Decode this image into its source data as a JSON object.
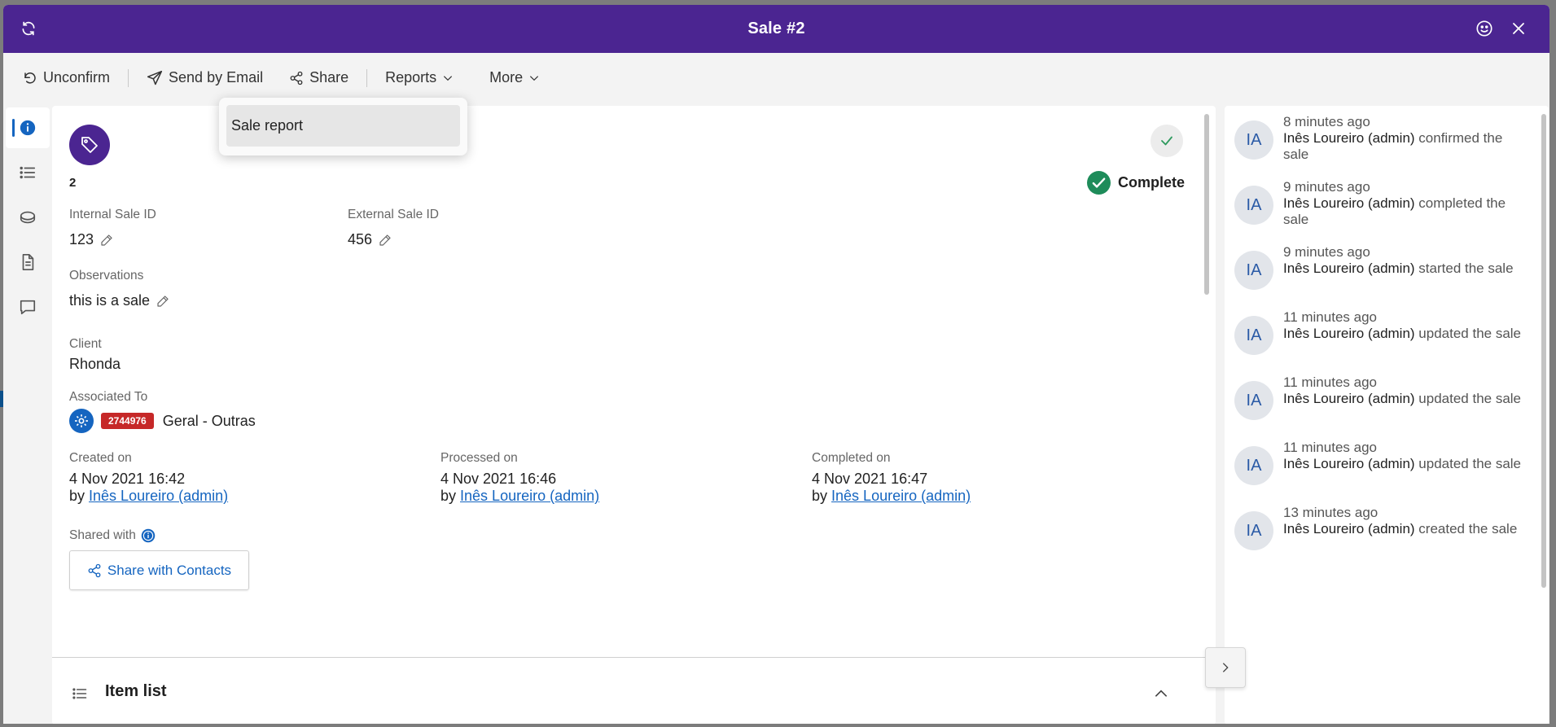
{
  "window": {
    "title": "Sale #2"
  },
  "toolbar": {
    "unconfirm": "Unconfirm",
    "send_email": "Send by Email",
    "share": "Share",
    "reports": "Reports",
    "more": "More"
  },
  "reports_menu": {
    "items": [
      "Sale report"
    ]
  },
  "sale": {
    "number": "2",
    "status": "Complete",
    "internal_id_label": "Internal Sale ID",
    "internal_id": "123",
    "external_id_label": "External Sale ID",
    "external_id": "456",
    "observations_label": "Observations",
    "observations": "this is a sale",
    "client_label": "Client",
    "client": "Rhonda",
    "associated_label": "Associated To",
    "associated_badge": "2744976",
    "associated_name": "Geral - Outras",
    "created_label": "Created on",
    "created_date": "4 Nov 2021 16:42",
    "processed_label": "Processed on",
    "processed_date": "4 Nov 2021 16:46",
    "completed_label": "Completed on",
    "completed_date": "4 Nov 2021 16:47",
    "by": "by",
    "user": "Inês Loureiro (admin)",
    "shared_label": "Shared with",
    "share_contacts": "Share with Contacts",
    "item_list": "Item list"
  },
  "activity": [
    {
      "initials": "IA",
      "time": "8 minutes ago",
      "user": "Inês Loureiro (admin)",
      "action": " confirmed the sale"
    },
    {
      "initials": "IA",
      "time": "9 minutes ago",
      "user": "Inês Loureiro (admin)",
      "action": " completed the sale"
    },
    {
      "initials": "IA",
      "time": "9 minutes ago",
      "user": "Inês Loureiro (admin)",
      "action": " started the sale"
    },
    {
      "initials": "IA",
      "time": "11 minutes ago",
      "user": "Inês Loureiro (admin)",
      "action": " updated the sale"
    },
    {
      "initials": "IA",
      "time": "11 minutes ago",
      "user": "Inês Loureiro (admin)",
      "action": " updated the sale"
    },
    {
      "initials": "IA",
      "time": "11 minutes ago",
      "user": "Inês Loureiro (admin)",
      "action": " updated the sale"
    },
    {
      "initials": "IA",
      "time": "13 minutes ago",
      "user": "Inês Loureiro (admin)",
      "action": " created the sale"
    }
  ],
  "colors": {
    "header": "#4b2591",
    "accent": "#1565c0",
    "success": "#1e8c5a",
    "badge": "#c62828"
  },
  "icons": [
    "refresh-icon",
    "smiley-icon",
    "close-icon",
    "undo-icon",
    "send-icon",
    "share-icon",
    "chevron-down-icon",
    "info-icon",
    "list-icon",
    "coins-icon",
    "document-icon",
    "comment-icon",
    "tag-icon",
    "check-icon",
    "pencil-icon",
    "gear-icon",
    "chevron-up-icon",
    "chevron-right-icon"
  ]
}
